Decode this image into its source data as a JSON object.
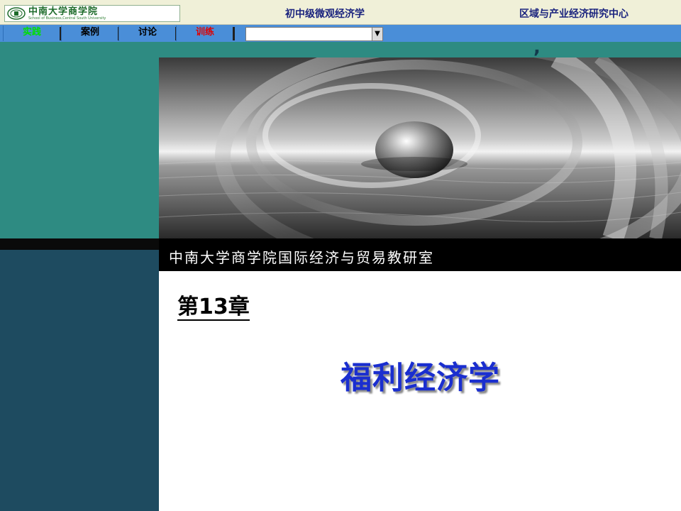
{
  "header": {
    "logo_main": "中南大学商学院",
    "logo_sub": "School of Business,Central South University",
    "course_title": "初中级微观经济学",
    "center_title": "区域与产业经济研究中心"
  },
  "nav": {
    "tabs": [
      {
        "label": "实践",
        "color": "#00e000"
      },
      {
        "label": "案例",
        "color": "#000000"
      },
      {
        "label": "讨论",
        "color": "#000000"
      },
      {
        "label": "训练",
        "color": "#e00000"
      }
    ],
    "select_value": "",
    "select_arrow": "▼"
  },
  "slide": {
    "department": "中南大学商学院国际经济与贸易教研室",
    "chapter": "第13章",
    "title": "福利经济学",
    "decorative_mark": ","
  },
  "colors": {
    "teal": "#2e8b82",
    "navy": "#1e4b60",
    "title_blue": "#1a2ecf",
    "nav_blue": "#4a8ed8"
  }
}
